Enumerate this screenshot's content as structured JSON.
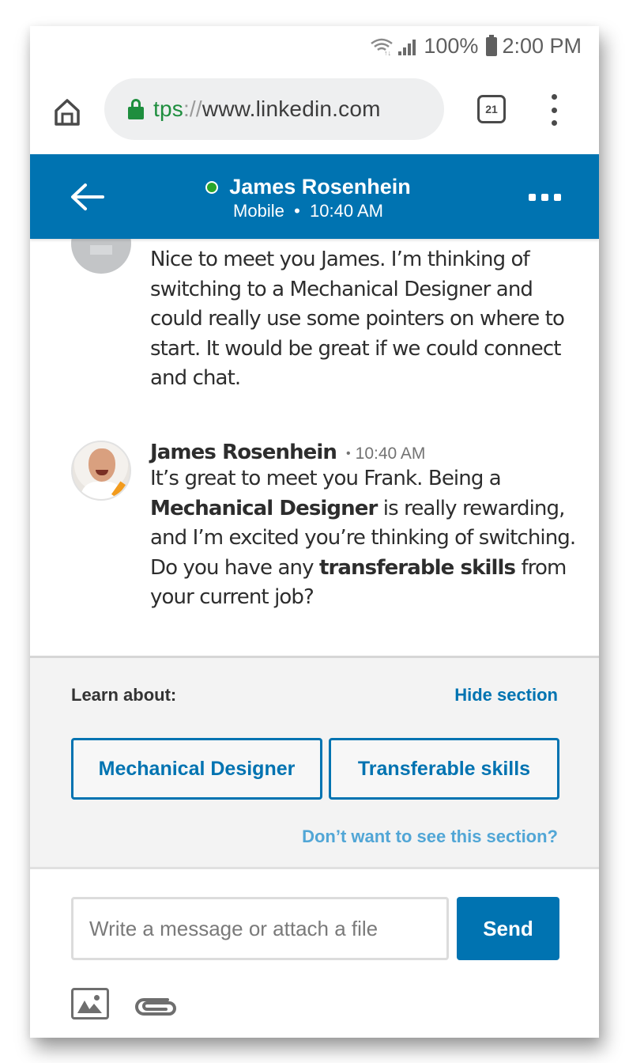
{
  "status_bar": {
    "battery": "100%",
    "time": "2:00 PM",
    "icons": [
      "wifi-icon",
      "signal-icon",
      "battery-icon"
    ]
  },
  "browser": {
    "url_scheme": "tps",
    "url_sep": "://",
    "url_host": "www.linkedin.com",
    "tab_count": "21",
    "icons": [
      "home-icon",
      "lock-icon",
      "tabs-icon",
      "overflow-menu-icon"
    ]
  },
  "chat_header": {
    "name": "James Rosenhein",
    "device": "Mobile",
    "separator": "•",
    "time": "10:40 AM",
    "presence_color": "#2aa52a",
    "background_color": "#0073b1"
  },
  "messages": [
    {
      "sender": "",
      "time": "",
      "parts": [
        {
          "text": "Nice to meet you James. I’m thinking of switching to a Mechanical Designer and could really use some pointers on where to start. It would be great if we could connect and chat.",
          "bold": false
        }
      ]
    },
    {
      "sender": "James Rosenhein",
      "time": "10:40 AM",
      "parts": [
        {
          "text": "It’s great to meet you Frank. Being a ",
          "bold": false
        },
        {
          "text": "Mechanical Designer",
          "bold": true
        },
        {
          "text": " is really rewarding, and I’m excited you’re thinking of switching. Do you have any ",
          "bold": false
        },
        {
          "text": "transferable skills",
          "bold": true
        },
        {
          "text": " from your current job?",
          "bold": false
        }
      ]
    }
  ],
  "learn_section": {
    "label": "Learn about:",
    "hide_link": "Hide section",
    "topics": [
      "Mechanical Designer",
      "Transferable skills"
    ],
    "dismiss_link": "Don’t want to see this section?"
  },
  "composer": {
    "placeholder": "Write a message or attach a file",
    "value": "",
    "send_label": "Send",
    "icons": [
      "image-icon",
      "paperclip-icon"
    ]
  }
}
